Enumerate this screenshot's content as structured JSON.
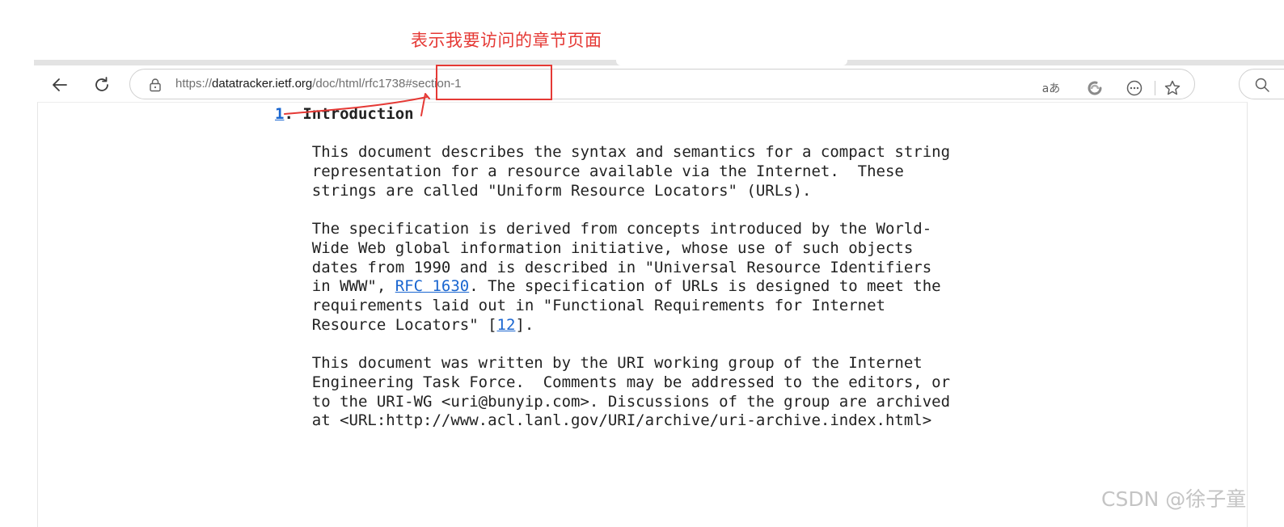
{
  "annotation": {
    "label": "表示我要访问的章节页面"
  },
  "browser": {
    "url_scheme": "https://",
    "url_domain": "datatracker.ietf.org",
    "url_path": "/doc/html/rfc1738#section-1",
    "read_aloud_icon_text": "aあ"
  },
  "document": {
    "section_number": "1",
    "section_title": ". Introduction",
    "para1": "This document describes the syntax and semantics for a compact string\nrepresentation for a resource available via the Internet.  These\nstrings are called \"Uniform Resource Locators\" (URLs).",
    "para2_part1": "The specification is derived from concepts introduced by the World-\nWide Web global information initiative, whose use of such objects\ndates from 1990 and is described in \"Universal Resource Identifiers\nin WWW\", ",
    "rfc_link": "RFC 1630",
    "para2_part2": ". The specification of URLs is designed to meet the\nrequirements laid out in \"Functional Requirements for Internet\nResource Locators\" [",
    "ref_link": "12",
    "para2_part3": "].",
    "para3": "This document was written by the URI working group of the Internet\nEngineering Task Force.  Comments may be addressed to the editors, or\nto the URI-WG <uri@bunyip.com>. Discussions of the group are archived\nat <URL:http://www.acl.lanl.gov/URI/archive/uri-archive.index.html>"
  },
  "watermark": {
    "text": "CSDN @徐子童"
  },
  "colors": {
    "annotation_red": "#e53935",
    "link_blue": "#1a66d0",
    "text_dark": "#222222"
  },
  "icons": [
    "back-arrow-icon",
    "refresh-icon",
    "lock-icon",
    "read-aloud-icon",
    "edge-copilot-icon",
    "more-options-icon",
    "favorite-star-icon",
    "search-icon"
  ]
}
